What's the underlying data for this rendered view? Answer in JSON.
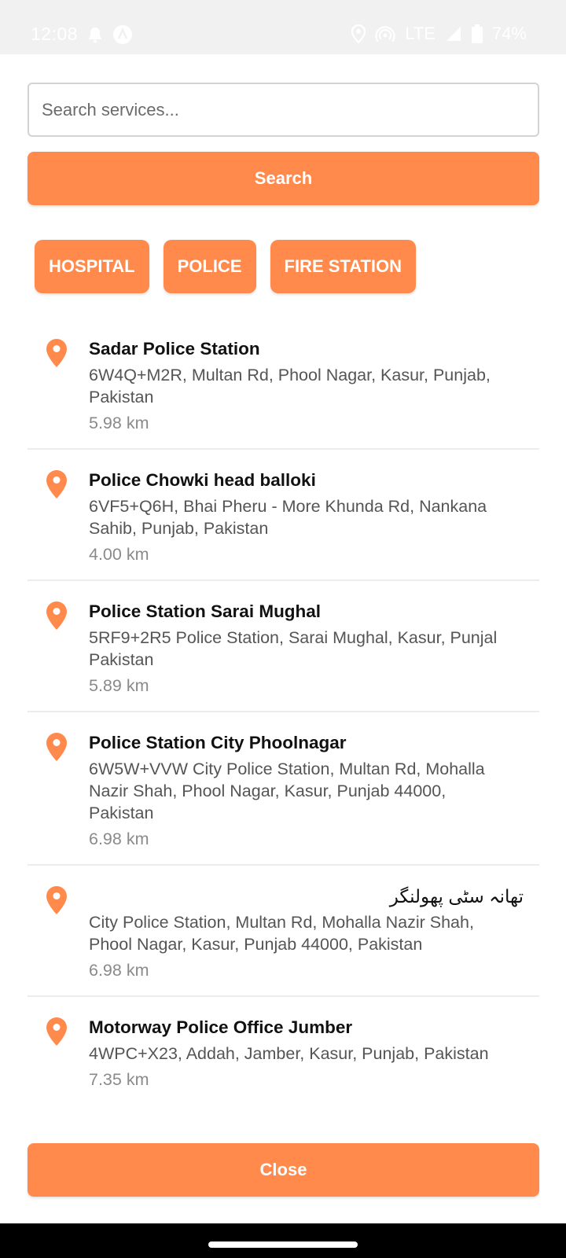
{
  "status_bar": {
    "time": "12:08",
    "network": "LTE",
    "battery": "74%",
    "icons": [
      "bell-icon",
      "assistant-icon",
      "location-icon",
      "hotspot-icon",
      "signal-icon",
      "battery-icon"
    ]
  },
  "search": {
    "placeholder": "Search services...",
    "button_label": "Search"
  },
  "categories": [
    {
      "label": "HOSPITAL"
    },
    {
      "label": "POLICE"
    },
    {
      "label": "FIRE STATION"
    }
  ],
  "results": [
    {
      "name": "Sadar Police Station",
      "address": "6W4Q+M2R, Multan Rd, Phool Nagar, Kasur, Punjab,\nPakistan",
      "distance": "5.98 km"
    },
    {
      "name": "Police Chowki head balloki",
      "address": "6VF5+Q6H, Bhai Pheru - More Khunda Rd, Nankana\nSahib, Punjab, Pakistan",
      "distance": "4.00 km"
    },
    {
      "name": "Police Station Sarai Mughal",
      "address": "5RF9+2R5 Police Station, Sarai Mughal, Kasur, Punjal\nPakistan",
      "distance": "5.89 km"
    },
    {
      "name": "Police Station City Phoolnagar",
      "address": "6W5W+VVW City Police Station, Multan Rd, Mohalla\nNazir Shah, Phool Nagar, Kasur, Punjab 44000,\nPakistan",
      "distance": "6.98 km"
    },
    {
      "name": "تھانہ سٹی پھولنگر",
      "address": "City Police Station, Multan Rd, Mohalla Nazir Shah,\nPhool Nagar, Kasur, Punjab 44000, Pakistan",
      "distance": "6.98 km"
    },
    {
      "name": "Motorway Police Office Jumber",
      "address": "4WPC+X23, Addah, Jamber, Kasur, Punjab, Pakistan",
      "distance": "7.35 km"
    }
  ],
  "footer": {
    "close_label": "Close"
  },
  "colors": {
    "accent": "#ff8a4c",
    "divider": "#ececec",
    "status_bar_bg": "#f1f1f1"
  }
}
